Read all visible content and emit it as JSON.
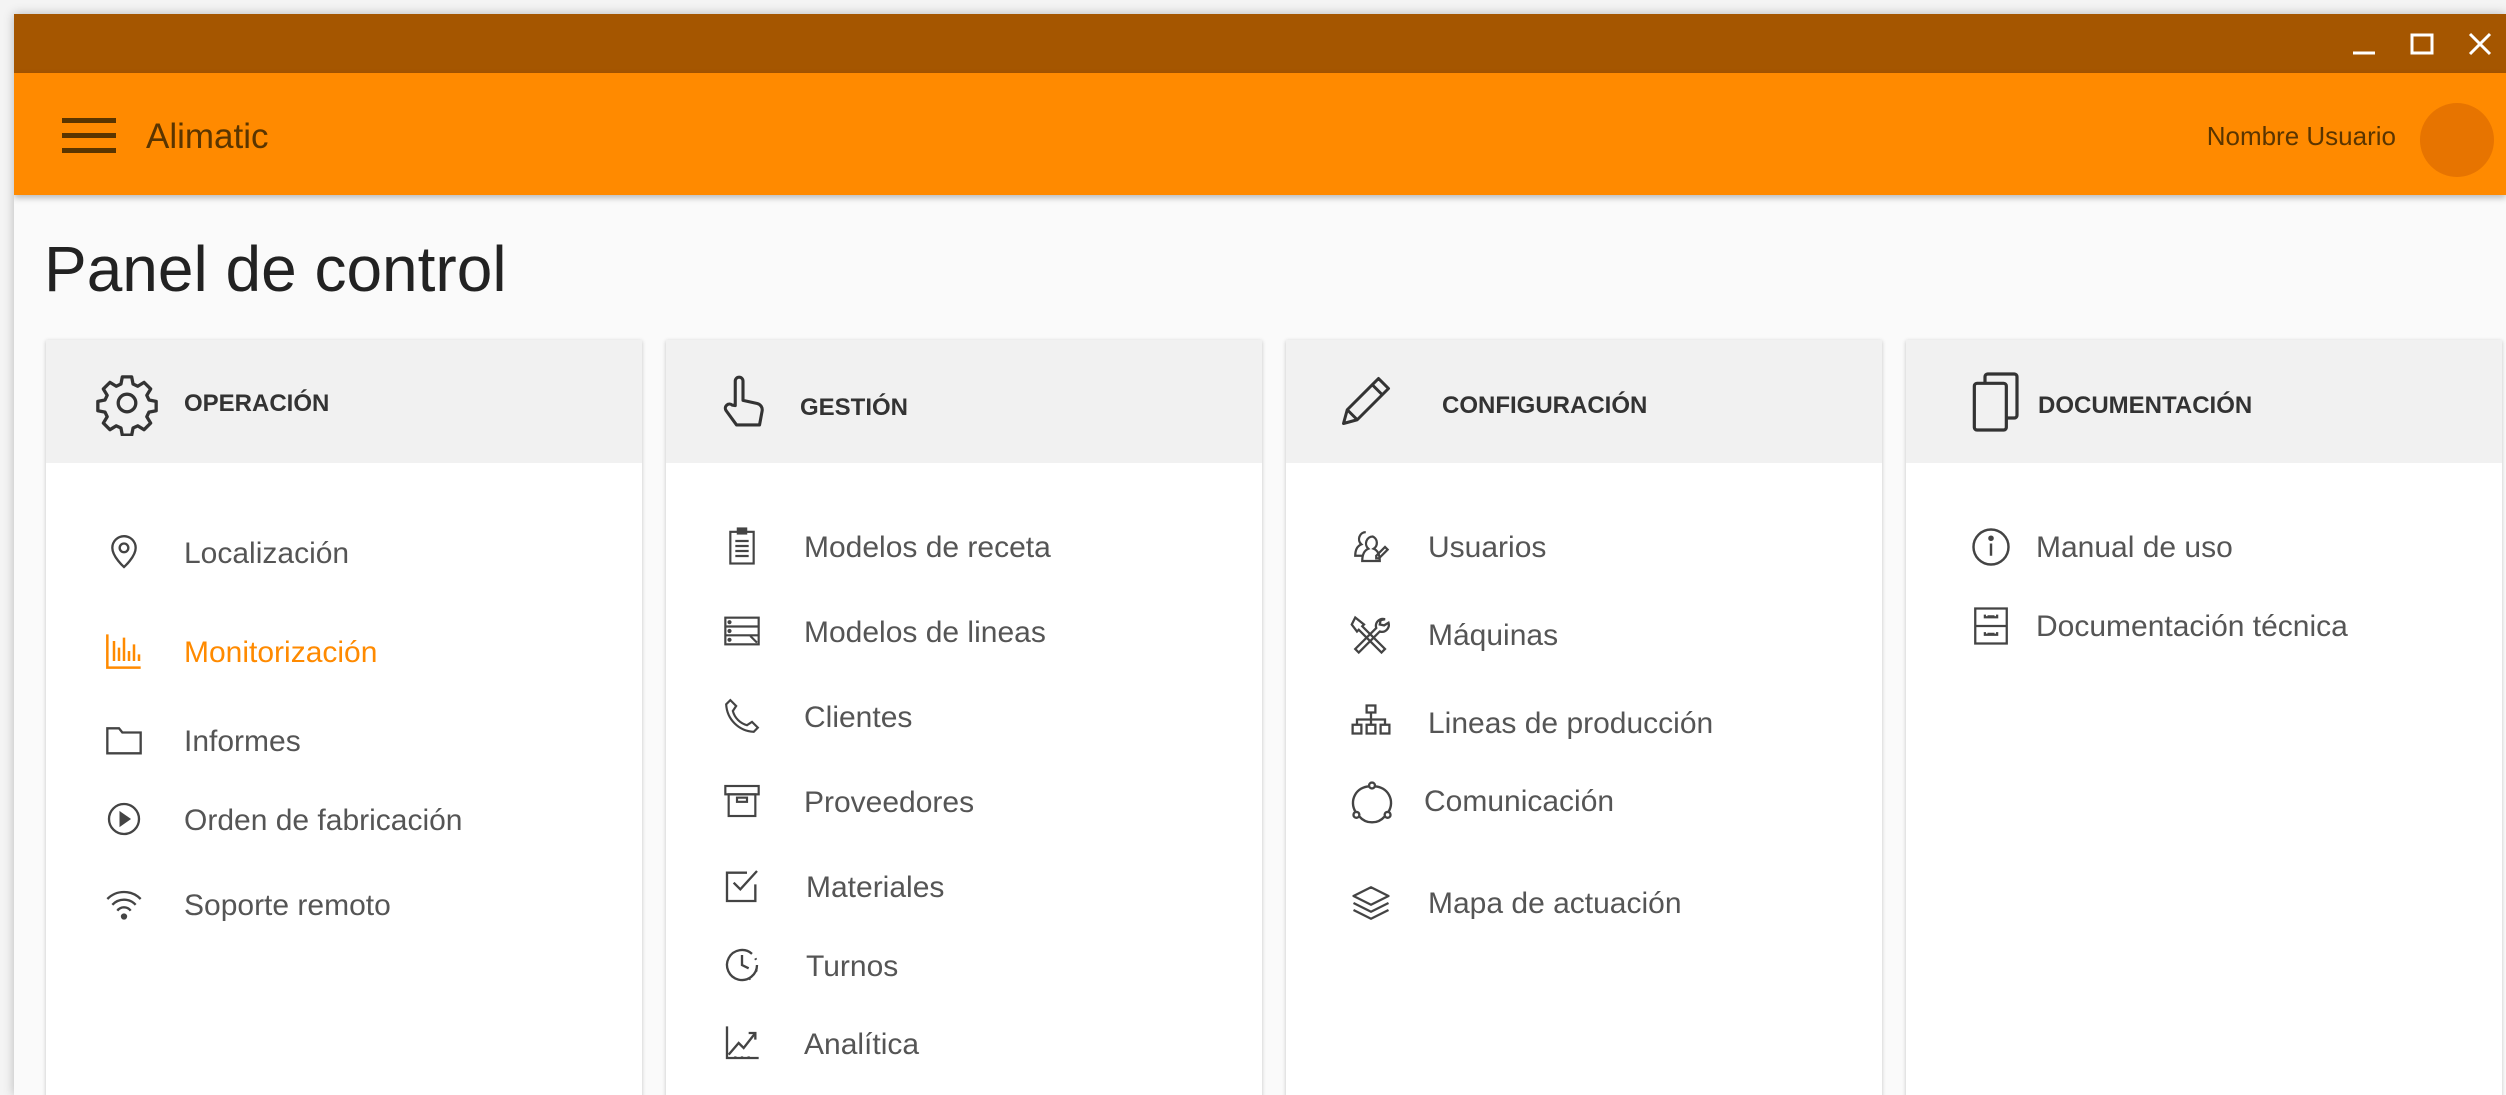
{
  "app": {
    "title": "Alimatic"
  },
  "user": {
    "name": "Nombre Usuario"
  },
  "page": {
    "title": "Panel de control"
  },
  "colors": {
    "titlebar": "#a55600",
    "appbar": "#ff8a00",
    "accent": "#ff8a00",
    "avatar": "#e77400"
  },
  "sections": [
    {
      "title": "OPERACIÓN",
      "icon": "gear-icon",
      "items": [
        {
          "label": "Localización",
          "icon": "location-pin-icon"
        },
        {
          "label": "Monitorización",
          "icon": "bar-chart-icon",
          "active": true
        },
        {
          "label": "Informes",
          "icon": "folder-icon"
        },
        {
          "label": "Orden de fabricación",
          "icon": "play-circle-icon"
        },
        {
          "label": "Soporte remoto",
          "icon": "wifi-icon"
        }
      ]
    },
    {
      "title": "GESTIÓN",
      "icon": "hand-pointer-icon",
      "items": [
        {
          "label": "Modelos de receta",
          "icon": "clipboard-icon"
        },
        {
          "label": "Modelos de lineas",
          "icon": "server-list-icon"
        },
        {
          "label": "Clientes",
          "icon": "phone-icon"
        },
        {
          "label": "Proveedores",
          "icon": "archive-box-icon"
        },
        {
          "label": "Materiales",
          "icon": "checkbox-icon"
        },
        {
          "label": "Turnos",
          "icon": "clock-icon"
        },
        {
          "label": "Analítica",
          "icon": "trend-chart-icon"
        }
      ]
    },
    {
      "title": "CONFIGURACIÓN",
      "icon": "pencil-icon",
      "items": [
        {
          "label": "Usuarios",
          "icon": "users-icon"
        },
        {
          "label": "Máquinas",
          "icon": "tools-icon"
        },
        {
          "label": "Lineas de producción",
          "icon": "hierarchy-icon"
        },
        {
          "label": "Comunicación",
          "icon": "network-cycle-icon"
        },
        {
          "label": "Mapa de actuación",
          "icon": "layers-icon"
        }
      ]
    },
    {
      "title": "DOCUMENTACIÓN",
      "icon": "documents-icon",
      "items": [
        {
          "label": "Manual de uso",
          "icon": "info-icon"
        },
        {
          "label": "Documentación técnica",
          "icon": "file-cabinet-icon"
        }
      ]
    }
  ]
}
